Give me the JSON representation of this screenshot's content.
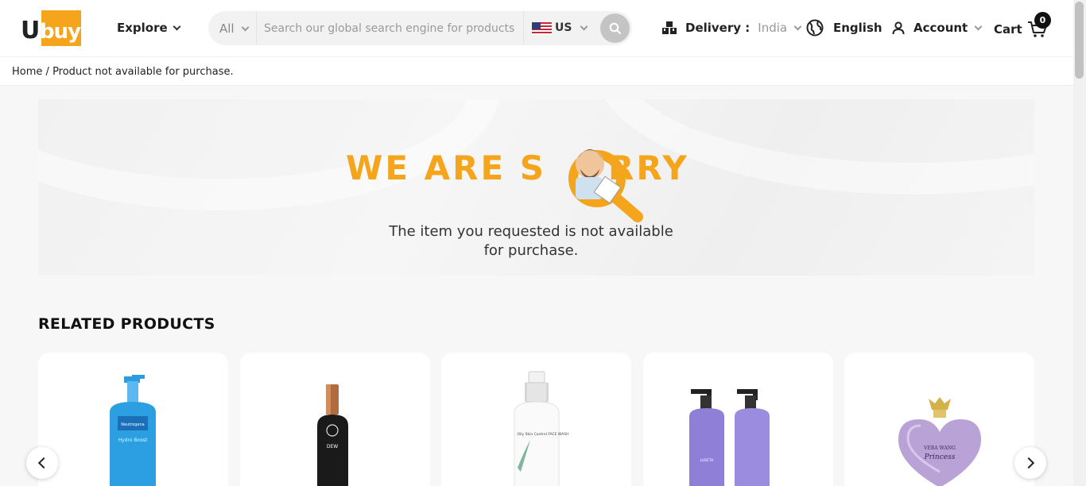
{
  "header": {
    "logo_text": "Ubuy",
    "explore_label": "Explore",
    "search": {
      "category": "All",
      "placeholder": "Search our global search engine for products",
      "country": "US"
    },
    "delivery_label": "Delivery :",
    "delivery_value": "India",
    "language": "English",
    "account_label": "Account",
    "cart_label": "Cart",
    "cart_count": "0"
  },
  "breadcrumb": {
    "home": "Home",
    "separator": "/",
    "current": "Product not available for purchase."
  },
  "banner": {
    "title_part1": "WE ARE S",
    "title_part2": "RRY",
    "message_line1": "The item you requested is not available",
    "message_line2": "for purchase."
  },
  "related": {
    "title": "RELATED PRODUCTS",
    "products": [
      {
        "icon": "lotion-bottle-icon",
        "brand_text": "Neutrogena",
        "label_text": "Hydro Boost"
      },
      {
        "icon": "toner-bottle-icon",
        "brand_text": "DEW"
      },
      {
        "icon": "spray-bottle-icon",
        "label_text": "Oily Skin Control FACE WASH"
      },
      {
        "icon": "pump-bottles-icon",
        "brand_text": "LUSETA"
      },
      {
        "icon": "perfume-bottle-icon",
        "brand_text": "VERA WANG",
        "label_text": "Princess"
      }
    ]
  },
  "colors": {
    "brand": "#f4a51c",
    "text": "#222222",
    "background": "#f7f7f7"
  }
}
